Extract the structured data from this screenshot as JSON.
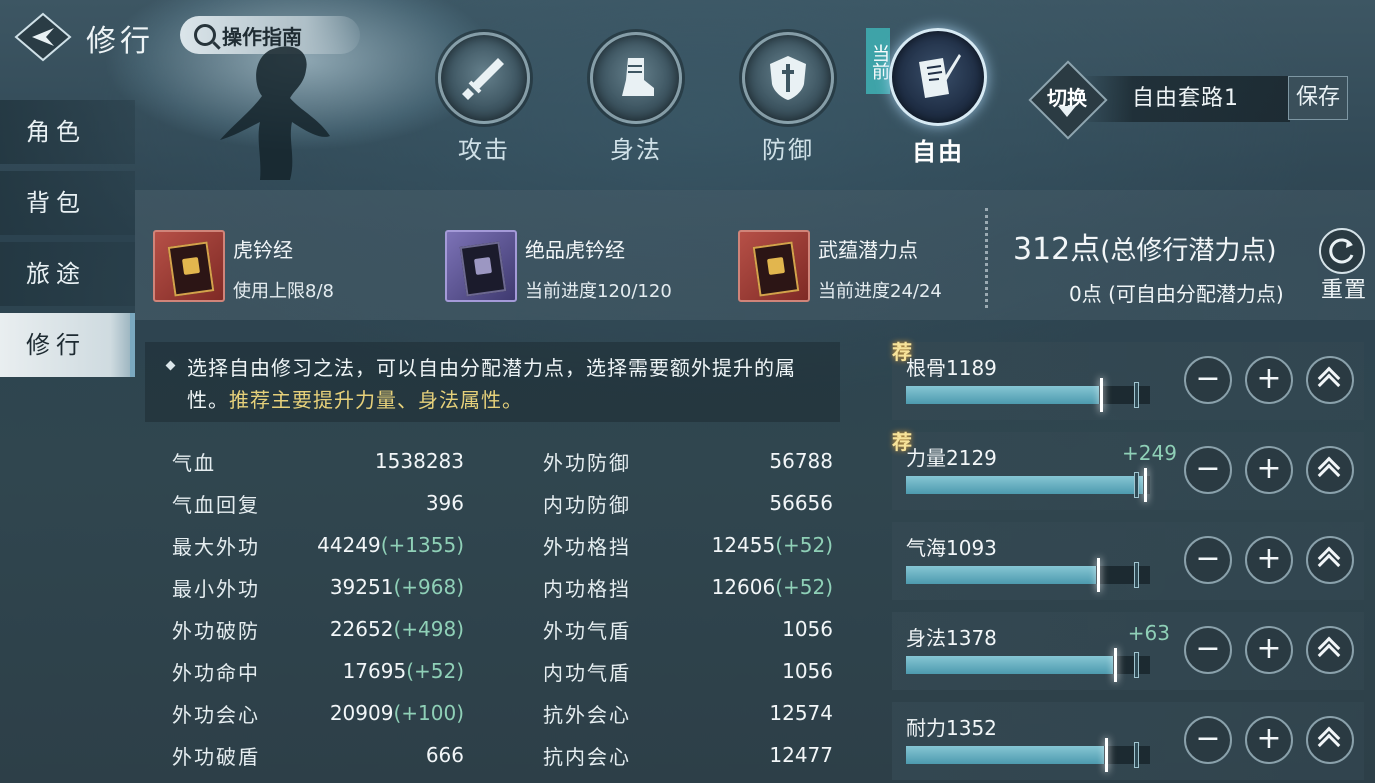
{
  "header": {
    "title": "修行",
    "guide_label": "操作指南"
  },
  "nav": [
    {
      "label": "角色",
      "active": false
    },
    {
      "label": "背包",
      "active": false
    },
    {
      "label": "旅途",
      "active": false
    },
    {
      "label": "修行",
      "active": true
    }
  ],
  "paths": {
    "current_tag": "当前",
    "tabs": [
      {
        "label": "攻击",
        "icon": "sword-icon"
      },
      {
        "label": "身法",
        "icon": "boot-icon"
      },
      {
        "label": "防御",
        "icon": "shield-icon"
      },
      {
        "label": "自由",
        "icon": "book-quill-icon",
        "active": true
      }
    ]
  },
  "preset": {
    "switch_label": "切换",
    "name": "自由套路1",
    "save_label": "保存"
  },
  "items": [
    {
      "name": "虎钤经",
      "sub": "使用上限8/8",
      "rarity": "red"
    },
    {
      "name": "绝品虎钤经",
      "sub": "当前进度120/120",
      "rarity": "purple"
    },
    {
      "name": "武蕴潜力点",
      "sub": "当前进度24/24",
      "rarity": "red"
    }
  ],
  "potential": {
    "total": "312点",
    "total_suffix": "(总修行潜力点)",
    "free": "0点 (可自由分配潜力点)",
    "reset_label": "重置"
  },
  "tip": {
    "text": "选择自由修习之法，可以自由分配潜力点，选择需要额外提升的属性。",
    "highlight": "推荐主要提升力量、身法属性。"
  },
  "stats_left": [
    {
      "k": "气血",
      "v": "1538283",
      "b": ""
    },
    {
      "k": "气血回复",
      "v": "396",
      "b": ""
    },
    {
      "k": "最大外功",
      "v": "44249",
      "b": "(+1355)"
    },
    {
      "k": "最小外功",
      "v": "39251",
      "b": "(+968)"
    },
    {
      "k": "外功破防",
      "v": "22652",
      "b": "(+498)"
    },
    {
      "k": "外功命中",
      "v": "17695",
      "b": "(+52)"
    },
    {
      "k": "外功会心",
      "v": "20909",
      "b": "(+100)"
    },
    {
      "k": "外功破盾",
      "v": "666",
      "b": ""
    }
  ],
  "stats_right": [
    {
      "k": "外功防御",
      "v": "56788",
      "b": ""
    },
    {
      "k": "内功防御",
      "v": "56656",
      "b": ""
    },
    {
      "k": "外功格挡",
      "v": "12455",
      "b": "(+52)"
    },
    {
      "k": "内功格挡",
      "v": "12606",
      "b": "(+52)"
    },
    {
      "k": "外功气盾",
      "v": "1056",
      "b": ""
    },
    {
      "k": "内功气盾",
      "v": "1056",
      "b": ""
    },
    {
      "k": "抗外会心",
      "v": "12574",
      "b": ""
    },
    {
      "k": "抗内会心",
      "v": "12477",
      "b": ""
    }
  ],
  "attributes": [
    {
      "name": "根骨1189",
      "bonus": "",
      "recommended": true,
      "rec_label": "荐",
      "fill": 0.79
    },
    {
      "name": "力量2129",
      "bonus": "+249",
      "recommended": true,
      "rec_label": "荐",
      "fill": 0.97
    },
    {
      "name": "气海1093",
      "bonus": "",
      "recommended": false,
      "rec_label": "",
      "fill": 0.78
    },
    {
      "name": "身法1378",
      "bonus": "+63",
      "recommended": false,
      "rec_label": "",
      "fill": 0.85
    },
    {
      "name": "耐力1352",
      "bonus": "",
      "recommended": false,
      "rec_label": "",
      "fill": 0.81
    }
  ],
  "buttons": {
    "minus": "−",
    "plus": "+"
  }
}
